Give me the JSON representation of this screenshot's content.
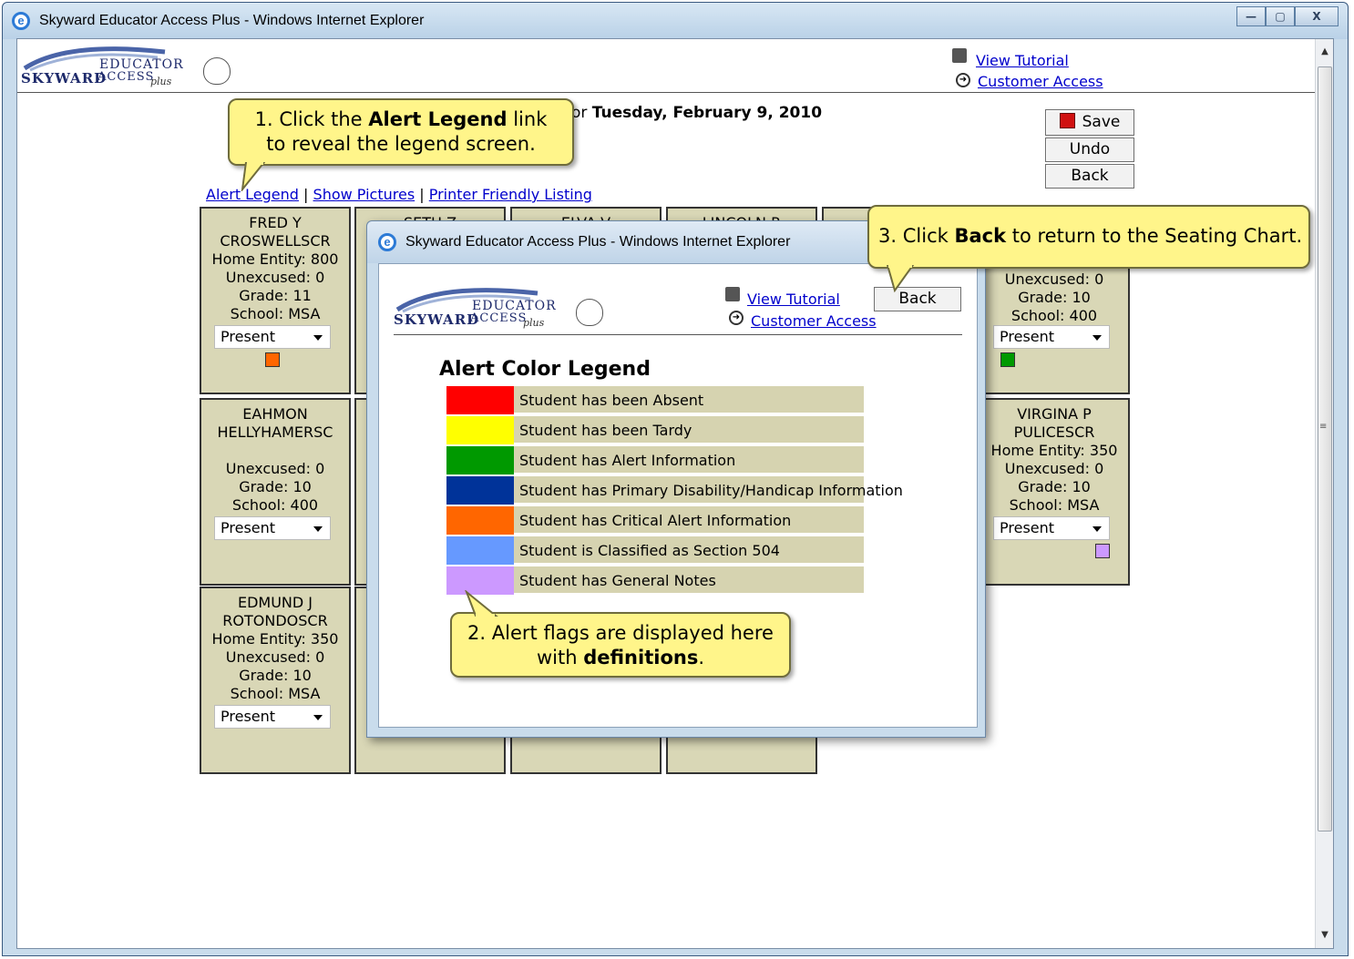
{
  "outer_window": {
    "title": "Skyward Educator Access Plus - Windows Internet Explorer",
    "controls": [
      "—",
      "▢",
      "X"
    ]
  },
  "header": {
    "logo": {
      "brand": "SKYWARD",
      "product": "EDUCATOR",
      "sub": "ACCESS",
      "plus": "plus"
    },
    "view_tutorial": "View Tutorial",
    "customer_access": "Customer Access"
  },
  "page": {
    "date_prefix": "or",
    "date": "Tuesday, February 9, 2010",
    "links": {
      "alert_legend": "Alert Legend",
      "sep1": "|",
      "show_pictures": "Show Pictures",
      "sep2": "|",
      "printer_friendly": "Printer Friendly Listing"
    },
    "buttons": {
      "save": "Save",
      "undo": "Undo",
      "back": "Back"
    }
  },
  "students": [
    {
      "first": "FRED Y",
      "last": "CROSWELLSCR",
      "home": "Home Entity: 800",
      "unexcused": "Unexcused: 0",
      "grade": "Grade: 11",
      "school": "School: MSA",
      "status": "Present",
      "flag": "#ff6600"
    },
    {
      "first": "EAHMON",
      "last": "HELLYHAMERSC",
      "home": "",
      "unexcused": "Unexcused: 0",
      "grade": "Grade: 10",
      "school": "School: 400",
      "status": "Present",
      "flag": ""
    },
    {
      "first": "EDMUND J",
      "last": "ROTONDOSCR",
      "home": "Home Entity: 350",
      "unexcused": "Unexcused: 0",
      "grade": "Grade: 10",
      "school": "School: MSA",
      "status": "Present",
      "flag": ""
    },
    {
      "first": "",
      "last": "",
      "home": "",
      "unexcused": "Unexcused: 0",
      "grade": "Grade: 10",
      "school": "School: 400",
      "status": "Present",
      "flag": "#009900"
    },
    {
      "first": "VIRGINA P",
      "last": "PULICESCR",
      "home": "Home Entity: 350",
      "unexcused": "Unexcused: 0",
      "grade": "Grade: 10",
      "school": "School: MSA",
      "status": "Present",
      "flag": "#cc99ff"
    }
  ],
  "partial_names": [
    "SETH Z",
    "ELVA V",
    "LINCOLN R",
    "E"
  ],
  "popup": {
    "title": "Skyward Educator Access Plus - Windows Internet Explorer",
    "view_tutorial": "View Tutorial",
    "customer_access": "Customer Access",
    "back": "Back",
    "legend_title": "Alert Color Legend",
    "legend": [
      {
        "color": "#ff0000",
        "label": "Student has been Absent"
      },
      {
        "color": "#ffff00",
        "label": "Student has been Tardy"
      },
      {
        "color": "#009900",
        "label": "Student has Alert Information"
      },
      {
        "color": "#003399",
        "label": "Student has Primary Disability/Handicap Information"
      },
      {
        "color": "#ff6600",
        "label": "Student has Critical Alert Information"
      },
      {
        "color": "#6699ff",
        "label": "Student is Classified as Section 504"
      },
      {
        "color": "#cc99ff",
        "label": "Student has General Notes"
      }
    ]
  },
  "callouts": {
    "c1": {
      "num": "1.",
      "pre": "Click the",
      "bold": "Alert Legend",
      "post": "link",
      "line2": "to reveal the legend screen."
    },
    "c2": {
      "num": "2.",
      "line1": "Alert flags are displayed here",
      "pre2": "with",
      "bold": "definitions",
      "post2": "."
    },
    "c3": {
      "num": "3.",
      "pre": "Click",
      "bold": "Back",
      "post": "to return to the Seating Chart."
    }
  }
}
